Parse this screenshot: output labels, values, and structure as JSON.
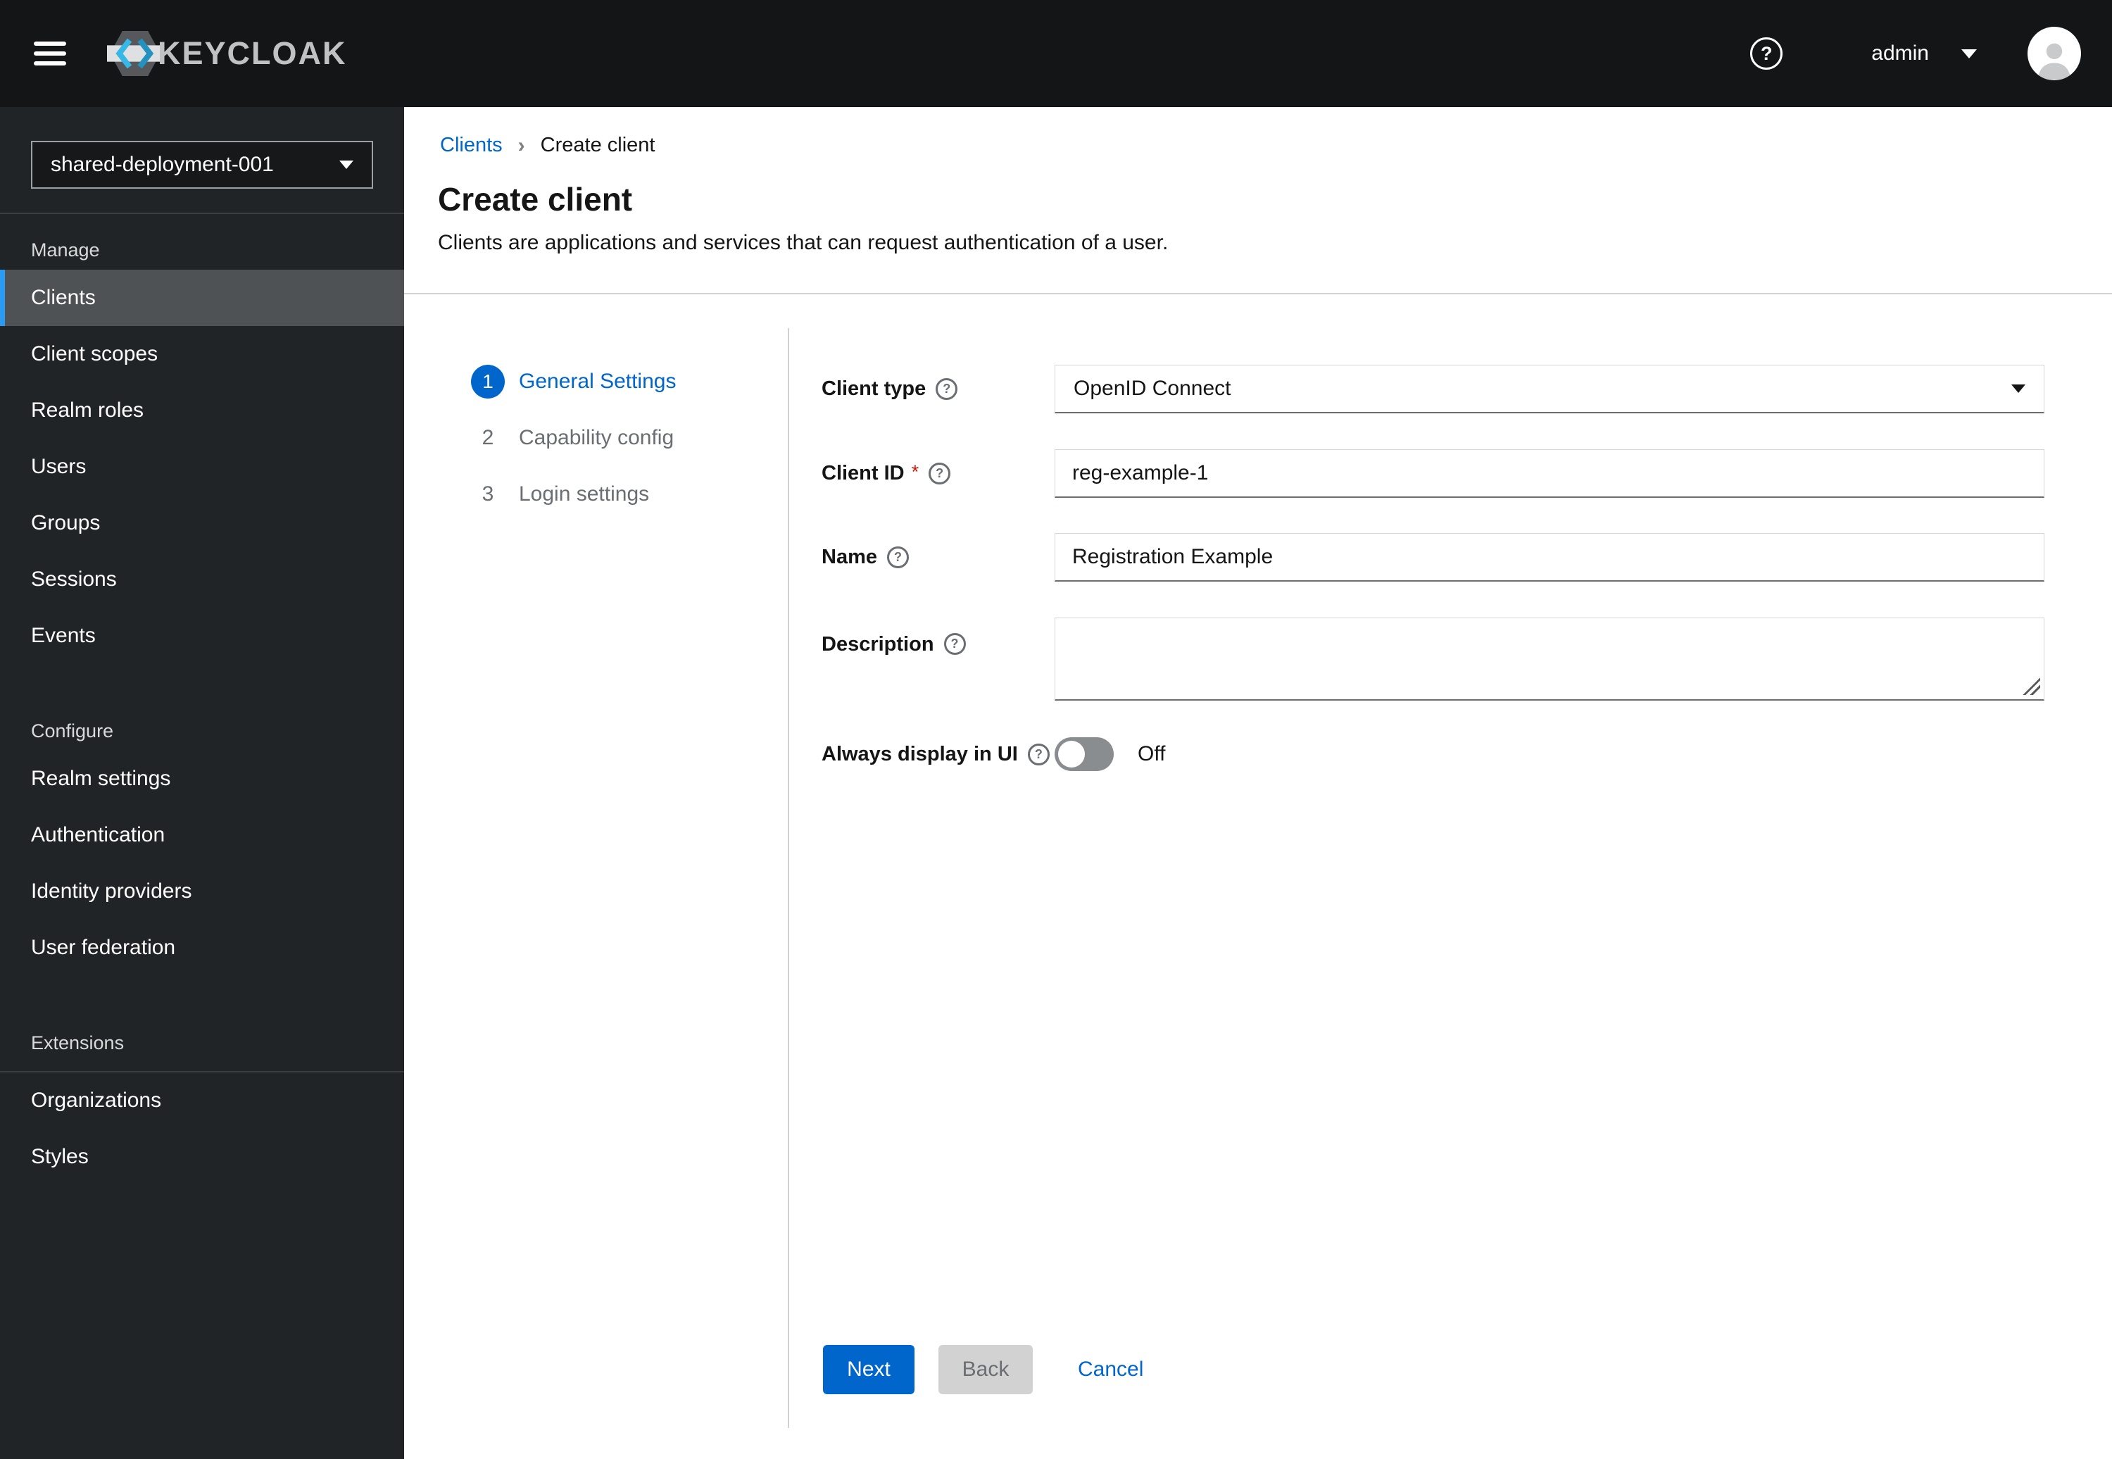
{
  "header": {
    "brand": "KEYCLOAK",
    "username": "admin"
  },
  "icons": {
    "help": "?",
    "breadcrumb_separator": "›"
  },
  "sidebar": {
    "realm_selector": {
      "value": "shared-deployment-001"
    },
    "sections": [
      {
        "title": "Manage",
        "items": [
          {
            "label": "Clients",
            "selected": true
          },
          {
            "label": "Client scopes"
          },
          {
            "label": "Realm roles"
          },
          {
            "label": "Users"
          },
          {
            "label": "Groups"
          },
          {
            "label": "Sessions"
          },
          {
            "label": "Events"
          }
        ]
      },
      {
        "title": "Configure",
        "items": [
          {
            "label": "Realm settings"
          },
          {
            "label": "Authentication"
          },
          {
            "label": "Identity providers"
          },
          {
            "label": "User federation"
          }
        ]
      },
      {
        "title": "Extensions",
        "items": [
          {
            "label": "Organizations"
          },
          {
            "label": "Styles"
          }
        ]
      }
    ]
  },
  "breadcrumb": {
    "parent": "Clients",
    "current": "Create client"
  },
  "page": {
    "title": "Create client",
    "subtitle": "Clients are applications and services that can request authentication of a user."
  },
  "wizard": {
    "steps": [
      {
        "number": "1",
        "label": "General Settings",
        "active": true
      },
      {
        "number": "2",
        "label": "Capability config",
        "active": false
      },
      {
        "number": "3",
        "label": "Login settings",
        "active": false
      }
    ]
  },
  "form": {
    "client_type": {
      "label": "Client type",
      "value": "OpenID Connect"
    },
    "client_id": {
      "label": "Client ID",
      "required_marker": "*",
      "value": "reg-example-1"
    },
    "name": {
      "label": "Name",
      "value": "Registration Example"
    },
    "description": {
      "label": "Description",
      "value": ""
    },
    "always_display_in_ui": {
      "label": "Always display in UI",
      "state_label": "Off",
      "enabled": false
    }
  },
  "actions": {
    "next": "Next",
    "back": "Back",
    "cancel": "Cancel"
  },
  "colors": {
    "primary_blue": "#0066cc",
    "nav_accent_blue": "#2b9af3",
    "masthead_bg": "#131517",
    "sidebar_bg": "#212427",
    "selected_item_bg": "#4f5255",
    "danger_red": "#c9190b"
  }
}
